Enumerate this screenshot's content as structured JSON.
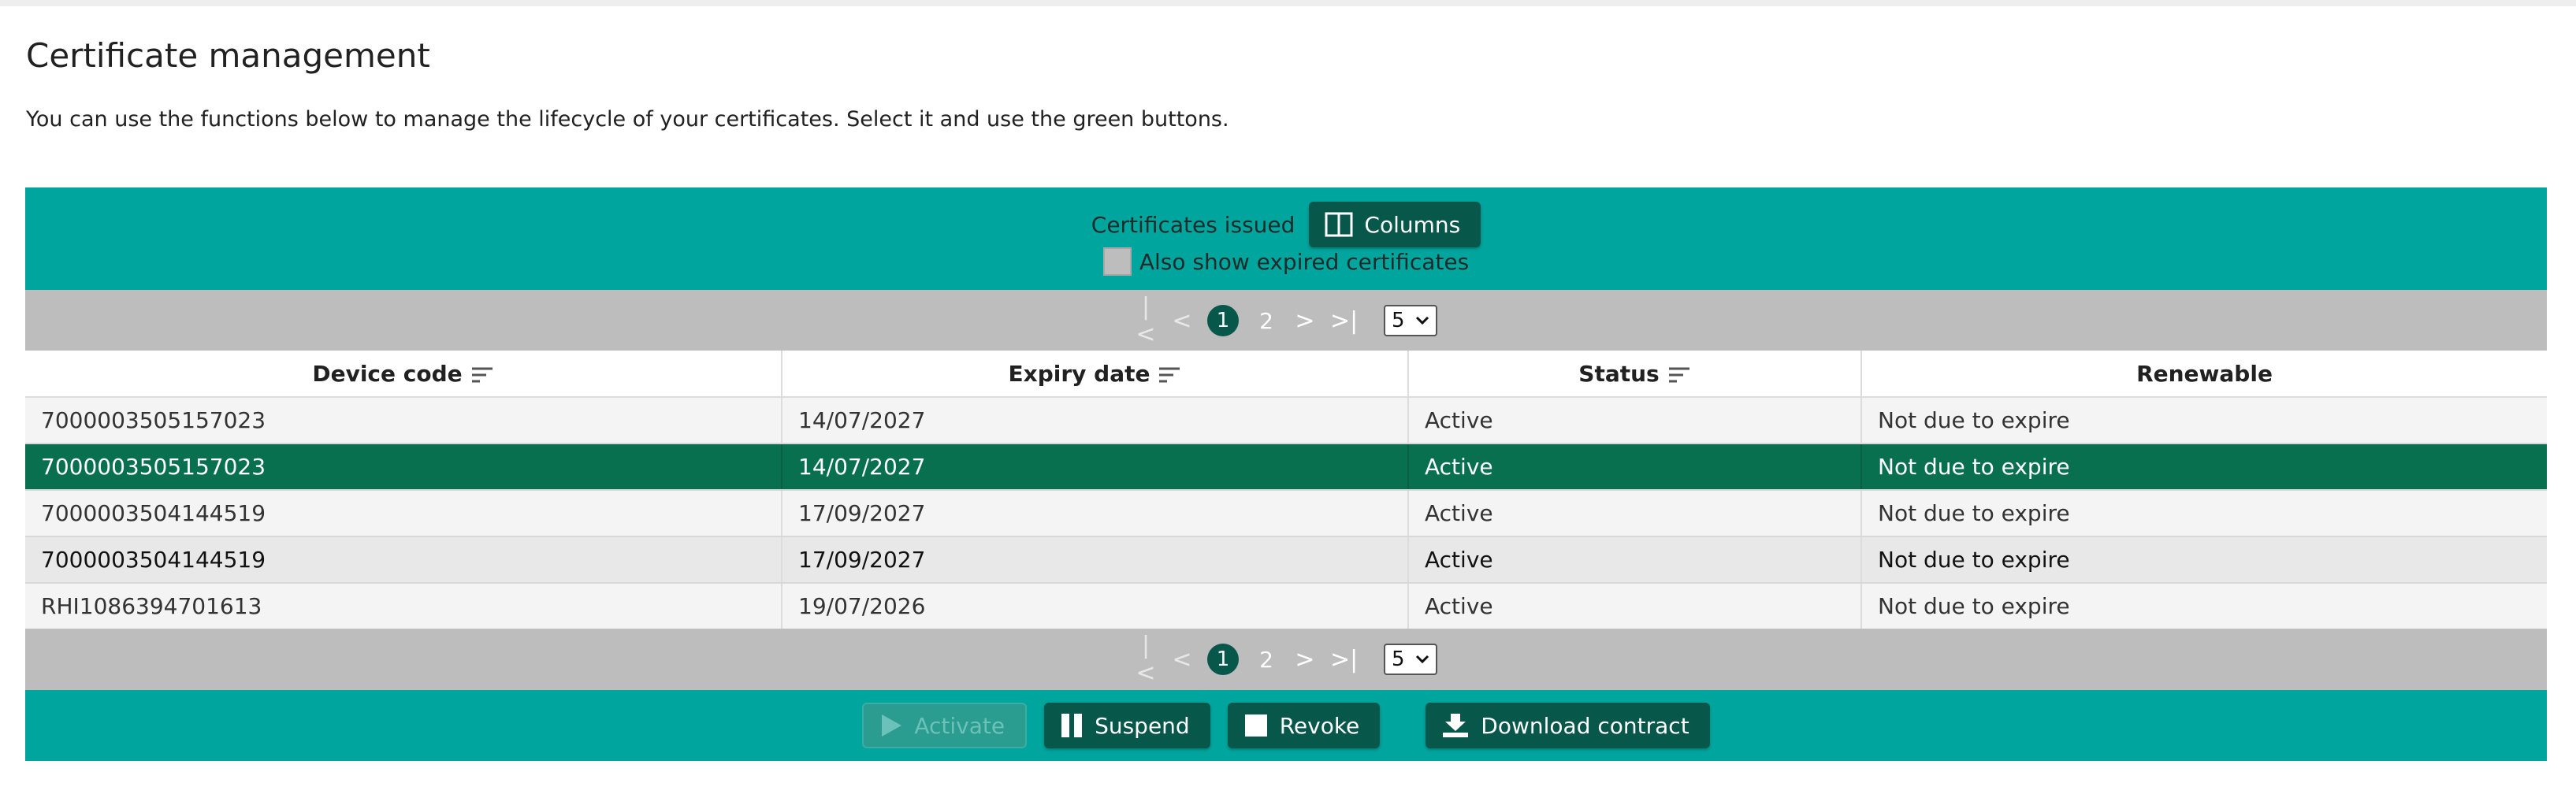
{
  "page": {
    "title": "Certificate management",
    "subtitle": "You can use the functions below to manage the lifecycle of your certificates. Select it and use the green buttons."
  },
  "header": {
    "caption": "Certificates issued",
    "columns_button": "Columns",
    "expired_checkbox_label": "Also show expired certificates",
    "expired_checked": false
  },
  "pager": {
    "current_page": "1",
    "other_page": "2",
    "page_size": "5",
    "first_icon": "first-page-icon",
    "prev_icon": "prev-page-icon",
    "next_icon": "next-page-icon",
    "last_icon": "last-page-icon"
  },
  "table": {
    "columns": [
      "Device code",
      "Expiry date",
      "Status",
      "Renewable"
    ],
    "rows": [
      {
        "device": "7000003505157023",
        "expiry": "14/07/2027",
        "status": "Active",
        "renewable": "Not due to expire",
        "selected": false
      },
      {
        "device": "7000003505157023",
        "expiry": "14/07/2027",
        "status": "Active",
        "renewable": "Not due to expire",
        "selected": true
      },
      {
        "device": "7000003504144519",
        "expiry": "17/09/2027",
        "status": "Active",
        "renewable": "Not due to expire",
        "selected": false
      },
      {
        "device": "7000003504144519",
        "expiry": "17/09/2027",
        "status": "Active",
        "renewable": "Not due to expire",
        "selected": false
      },
      {
        "device": "RHI1086394701613",
        "expiry": "19/07/2026",
        "status": "Active",
        "renewable": "Not due to expire",
        "selected": false
      }
    ]
  },
  "actions": {
    "activate": "Activate",
    "suspend": "Suspend",
    "revoke": "Revoke",
    "download": "Download contract"
  },
  "colors": {
    "accent_teal": "#00a59d",
    "dark_green": "#08574b",
    "selected_row": "#08704f",
    "pager_grey": "#bdbdbd"
  }
}
